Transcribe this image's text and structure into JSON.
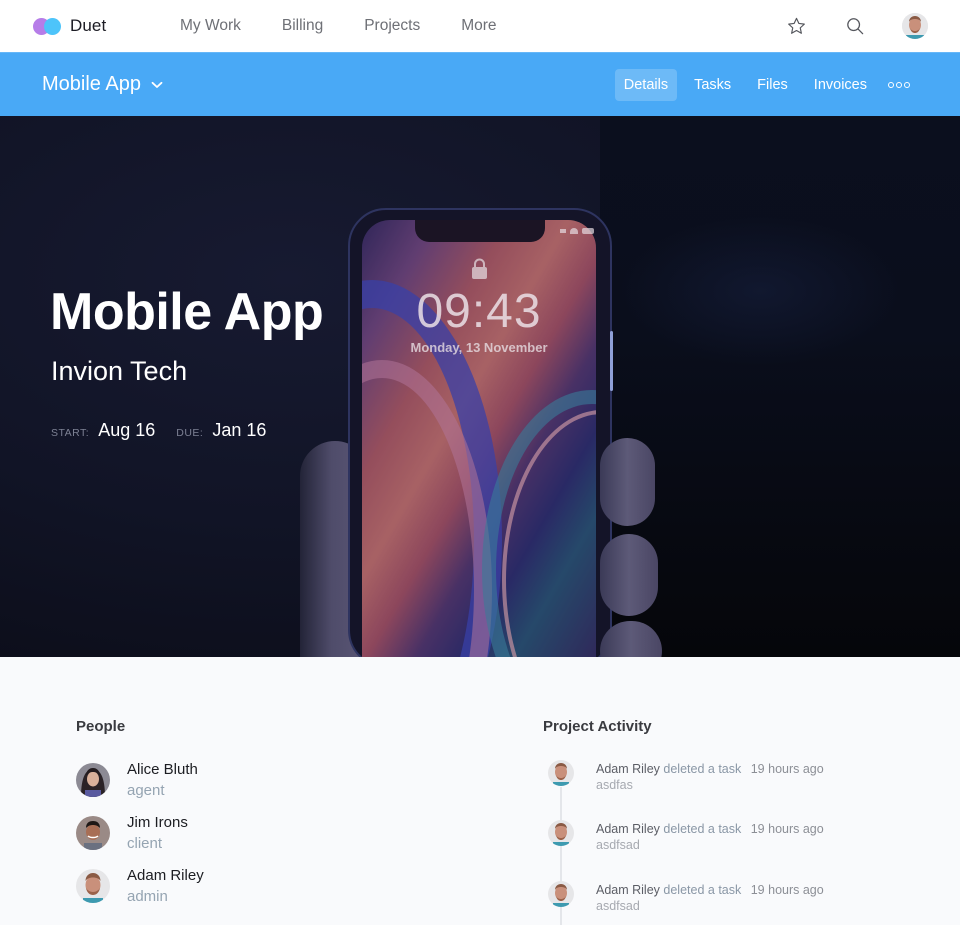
{
  "app": {
    "name": "Duet",
    "logo_colors": [
      "#b67de8",
      "#4dc4fa"
    ]
  },
  "topnav": {
    "links": [
      {
        "label": "My Work"
      },
      {
        "label": "Billing"
      },
      {
        "label": "Projects"
      },
      {
        "label": "More"
      }
    ],
    "icons": [
      "star-icon",
      "search-icon",
      "user-avatar"
    ]
  },
  "subnav": {
    "project_name": "Mobile App",
    "accent_color": "#49a9f6",
    "tabs": [
      {
        "label": "Details",
        "active": true
      },
      {
        "label": "Tasks",
        "active": false
      },
      {
        "label": "Files",
        "active": false
      },
      {
        "label": "Invoices",
        "active": false
      }
    ],
    "more_icon": "more-dots-icon"
  },
  "hero": {
    "title": "Mobile App",
    "client": "Invion Tech",
    "start_label": "START:",
    "start_value": "Aug 16",
    "due_label": "DUE:",
    "due_value": "Jan 16",
    "image": {
      "description": "hand holding smartphone on lock screen",
      "phone_time": "09:43",
      "phone_date": "Monday, 13 November"
    }
  },
  "people": {
    "title": "People",
    "items": [
      {
        "name": "Alice Bluth",
        "role": "agent"
      },
      {
        "name": "Jim Irons",
        "role": "client"
      },
      {
        "name": "Adam Riley",
        "role": "admin"
      }
    ]
  },
  "activity": {
    "title": "Project Activity",
    "items": [
      {
        "user": "Adam Riley",
        "action": "deleted a task",
        "time": "19 hours ago",
        "detail": "asdfas"
      },
      {
        "user": "Adam Riley",
        "action": "deleted a task",
        "time": "19 hours ago",
        "detail": "asdfsad"
      },
      {
        "user": "Adam Riley",
        "action": "deleted a task",
        "time": "19 hours ago",
        "detail": "asdfsad"
      }
    ]
  }
}
